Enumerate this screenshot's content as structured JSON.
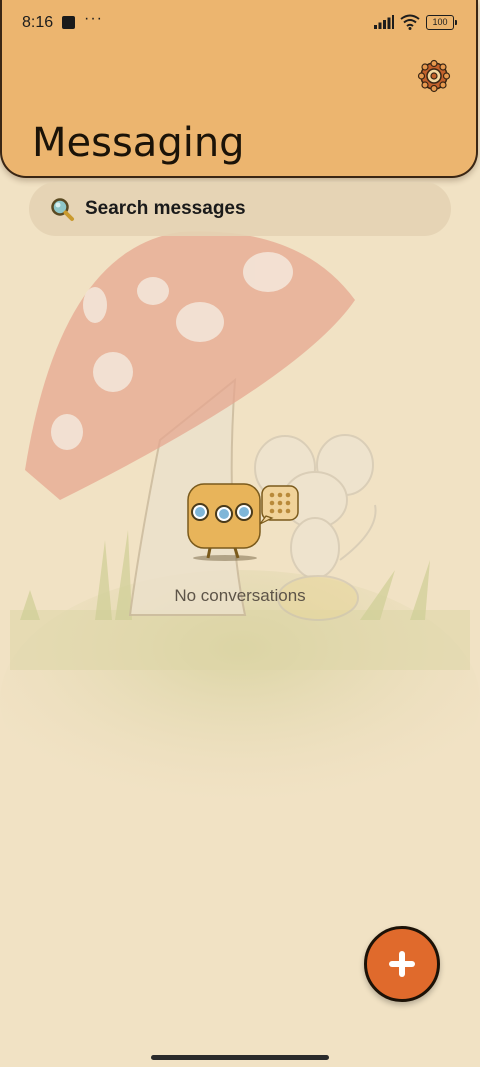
{
  "status_bar": {
    "time": "8:16",
    "more": "···",
    "battery": "100"
  },
  "header": {
    "title": "Messaging",
    "settings_icon": "gear-icon"
  },
  "search": {
    "placeholder": "Search messages",
    "icon": "search-icon"
  },
  "empty_state": {
    "text": "No conversations"
  },
  "fab": {
    "icon": "plus-icon"
  },
  "colors": {
    "background": "#f1e2c4",
    "header": "#ecb56f",
    "accent": "#e06a2c"
  }
}
